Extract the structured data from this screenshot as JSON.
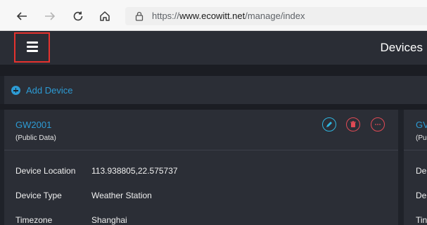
{
  "browser": {
    "url_prefix": "https://",
    "url_host": "www.ecowitt.net",
    "url_path": "/manage/index"
  },
  "header": {
    "title": "Devices"
  },
  "toolbar": {
    "add_device_label": "Add Device"
  },
  "device_card": {
    "name": "GW2001",
    "subtitle": "(Public Data)",
    "rows": [
      {
        "label": "Device Location",
        "value": "113.938805,22.575737"
      },
      {
        "label": "Device Type",
        "value": "Weather Station"
      },
      {
        "label": "Timezone",
        "value": "Shanghai"
      }
    ]
  },
  "device_card_partial": {
    "name": "GV",
    "subtitle": "(Pu",
    "rows": [
      "De",
      "De",
      "Tin"
    ]
  },
  "colors": {
    "accent": "#2d9bd4",
    "danger": "#e04a55",
    "highlight": "#e5322e"
  }
}
